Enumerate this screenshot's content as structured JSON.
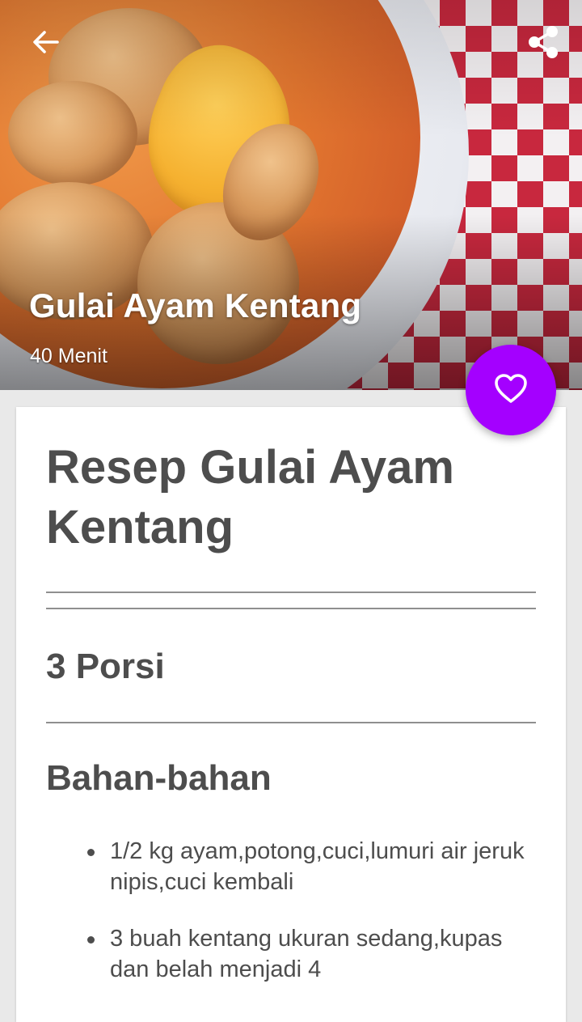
{
  "header": {
    "title": "Gulai Ayam Kentang",
    "duration": "40 Menit",
    "back_icon": "arrow-left-icon",
    "share_icon": "share-icon"
  },
  "favorite": {
    "icon": "heart-outline-icon",
    "color": "#a400ff"
  },
  "recipe": {
    "title": "Resep Gulai Ayam Kentang",
    "portion": "3 Porsi",
    "ingredients_heading": "Bahan-bahan",
    "ingredients": [
      "1/2 kg ayam,potong,cuci,lumuri air jeruk nipis,cuci kembali",
      "3 buah kentang ukuran sedang,kupas dan belah menjadi 4"
    ]
  },
  "colors": {
    "text": "#4d4d4d",
    "background": "#e9e9e9",
    "accent": "#a400ff"
  }
}
